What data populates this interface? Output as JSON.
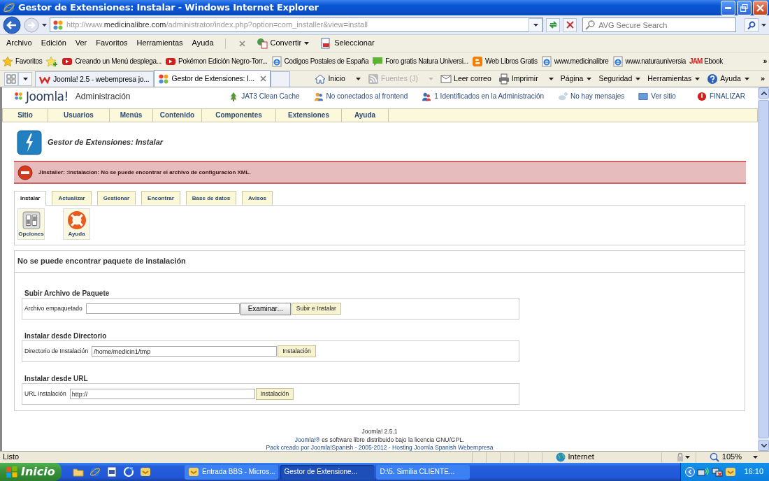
{
  "window": {
    "title": "Gestor de Extensiones: Instalar - Windows Internet Explorer"
  },
  "address": {
    "scheme": "http://www.",
    "domain": "medicinalibre.com",
    "path": "/administrator/index.php?option=com_installer&view=install"
  },
  "search": {
    "placeholder": "AVG Secure Search"
  },
  "menu": [
    "Archivo",
    "Edición",
    "Ver",
    "Favoritos",
    "Herramientas",
    "Ayuda"
  ],
  "toolbar": [
    {
      "label": "Convertir",
      "dropdown": true
    },
    {
      "label": "Seleccionar",
      "dropdown": false
    }
  ],
  "favorites": {
    "label": "Favoritos",
    "more": "»",
    "items": [
      {
        "label": "Creando un Menú desplega...",
        "kind": "video"
      },
      {
        "label": "Pokémon Edición Negro-Torr...",
        "kind": "video"
      },
      {
        "label": "Codigos Postales de España",
        "kind": "page"
      },
      {
        "label": "Foro gratis  Natura Universi...",
        "kind": "chat"
      },
      {
        "label": "Web Libros Gratis",
        "kind": "blog"
      },
      {
        "label": "www.medicinalibre",
        "kind": "page"
      },
      {
        "label": "www.naturauniversia",
        "kind": "page"
      },
      {
        "label": "Ebook",
        "kind": "badge",
        "badge": "JAM"
      }
    ]
  },
  "tabs": [
    {
      "label": "Joomla! 2.5 - webempresa jo...",
      "kind": "w",
      "selected": false
    },
    {
      "label": "Gestor de Extensiones: I...",
      "kind": "dots",
      "selected": true
    }
  ],
  "command_bar": {
    "more": "»",
    "items": [
      {
        "label": "Inicio",
        "kind": "home",
        "dropdown": true,
        "disabled": false
      },
      {
        "label": "Fuentes (J)",
        "kind": "feed",
        "dropdown": true,
        "disabled": true
      },
      {
        "label": "Leer correo",
        "kind": "mail",
        "dropdown": false,
        "disabled": false
      },
      {
        "label": "Imprimir",
        "kind": "print",
        "dropdown": true,
        "disabled": false
      },
      {
        "label": "Página",
        "kind": "plain",
        "dropdown": true,
        "disabled": false
      },
      {
        "label": "Seguridad",
        "kind": "plain",
        "dropdown": true,
        "disabled": false
      },
      {
        "label": "Herramientas",
        "kind": "plain",
        "dropdown": true,
        "disabled": false
      },
      {
        "label": "Ayuda",
        "kind": "help",
        "dropdown": true,
        "disabled": false
      }
    ]
  },
  "joomla": {
    "brand": "Joomla!",
    "title": "Administración",
    "status": [
      {
        "label": "JAT3 Clean Cache",
        "kind": "cache"
      },
      {
        "label": "No conectados al frontend",
        "kind": "users"
      },
      {
        "label": "1 Identificados en la Administración",
        "kind": "admins"
      },
      {
        "label": "No hay mensajes",
        "kind": "messages"
      },
      {
        "label": "Ver sitio",
        "kind": "site"
      },
      {
        "label": "FINALIZAR",
        "kind": "logout"
      }
    ],
    "menu": [
      "Sitio",
      "Usuarios",
      "Menús",
      "Contenido",
      "Componentes",
      "Extensiones",
      "Ayuda"
    ],
    "page_title": "Gestor de Extensiones: Instalar",
    "error": "JInstaller: :Instalacion: No se puede encontrar el archivo de configuracion XML.",
    "tabs": [
      {
        "label": "Instalar",
        "selected": true
      },
      {
        "label": "Actualizar",
        "selected": false
      },
      {
        "label": "Gestionar",
        "selected": false
      },
      {
        "label": "Encontrar",
        "selected": false
      },
      {
        "label": "Base de datos",
        "selected": false
      },
      {
        "label": "Avisos",
        "selected": false
      }
    ],
    "tools": [
      {
        "label": "Opciones",
        "kind": "options"
      },
      {
        "label": "Ayuda",
        "kind": "lifebuoy"
      }
    ],
    "heading": "No se puede encontrar paquete de instalación",
    "fieldsets": [
      {
        "legend": "Subir Archivo de Paquete",
        "label": "Archivo empaquetado",
        "buttons": [
          {
            "label": "Examinar...",
            "kind": "file"
          },
          {
            "label": "Subir e Instalar",
            "kind": "submit"
          }
        ]
      },
      {
        "legend": "Instalar desde Directorio",
        "label": "Directorio de Instalación",
        "value": "/home/medicin1/tmp",
        "buttons": [
          {
            "label": "Instalación",
            "kind": "submit"
          }
        ]
      },
      {
        "legend": "Instalar desde URL",
        "label": "URL Instalación",
        "value": "http://",
        "buttons": [
          {
            "label": "Instalación",
            "kind": "submit"
          }
        ]
      }
    ],
    "footer": {
      "version": "Joomla! 2.5.1",
      "license_link": "Joomla!®",
      "license_text": " es software libre distribuido bajo la licencia GNU/GPL.",
      "credit": "Pack creado por Joomla!Spanish - 2005-2012 - Hosting Joomla Spanish Webempresa"
    }
  },
  "status_bar": {
    "text": "Listo",
    "zone": "Internet",
    "zoom": "105%"
  },
  "taskbar": {
    "start": "Inicio",
    "windows": [
      {
        "label": "Entrada BBS - Micros...",
        "kind": "mail",
        "selected": false
      },
      {
        "label": "Gestor de Extensione...",
        "kind": "ie",
        "selected": true
      },
      {
        "label": "D:\\5. Similia CLIENTE...",
        "kind": "folder",
        "selected": false
      }
    ],
    "clock": "16:10"
  }
}
